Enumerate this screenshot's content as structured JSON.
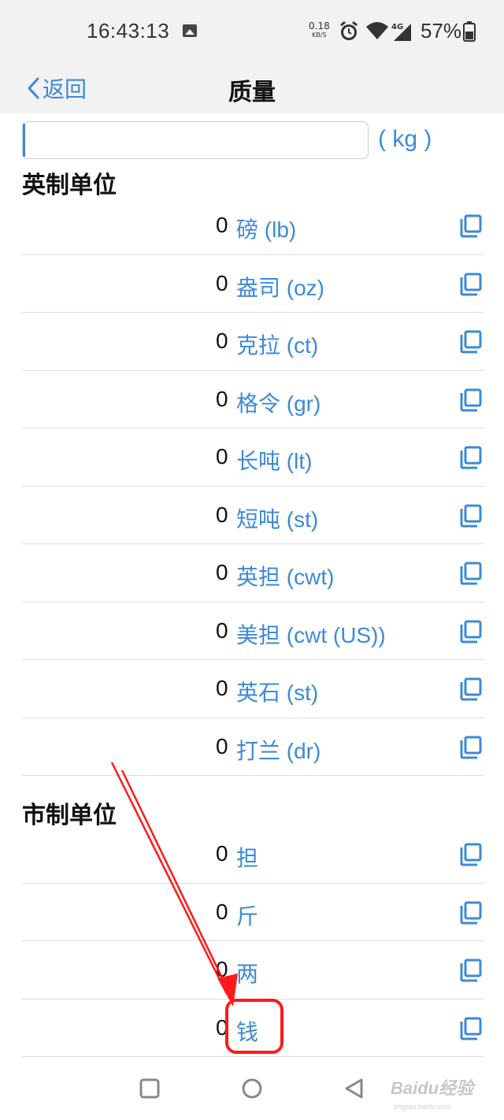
{
  "status_bar": {
    "time": "16:43:13",
    "net_speed_value": "0.18",
    "net_speed_unit": "KB/S",
    "network": "4G",
    "battery": "57%"
  },
  "nav": {
    "back_label": "返回",
    "title": "质量"
  },
  "input": {
    "value": "",
    "unit": "( kg )"
  },
  "imperial": {
    "title": "英制单位",
    "units": [
      {
        "value": "0",
        "name": "磅 (lb)"
      },
      {
        "value": "0",
        "name": "盎司 (oz)"
      },
      {
        "value": "0",
        "name": "克拉 (ct)"
      },
      {
        "value": "0",
        "name": "格令 (gr)"
      },
      {
        "value": "0",
        "name": "长吨 (lt)"
      },
      {
        "value": "0",
        "name": "短吨 (st)"
      },
      {
        "value": "0",
        "name": "英担 (cwt)"
      },
      {
        "value": "0",
        "name": "美担 (cwt (US))"
      },
      {
        "value": "0",
        "name": "英石 (st)"
      },
      {
        "value": "0",
        "name": "打兰 (dr)"
      }
    ]
  },
  "chinese": {
    "title": "市制单位",
    "units": [
      {
        "value": "0",
        "name": "担"
      },
      {
        "value": "0",
        "name": "斤"
      },
      {
        "value": "0",
        "name": "两"
      },
      {
        "value": "0",
        "name": "钱"
      }
    ]
  },
  "watermark": {
    "text": "Baidu经验",
    "sub": "jingyan.baidu.com"
  },
  "colors": {
    "accent": "#3c8ad7",
    "annotation": "#ff1a1a"
  }
}
